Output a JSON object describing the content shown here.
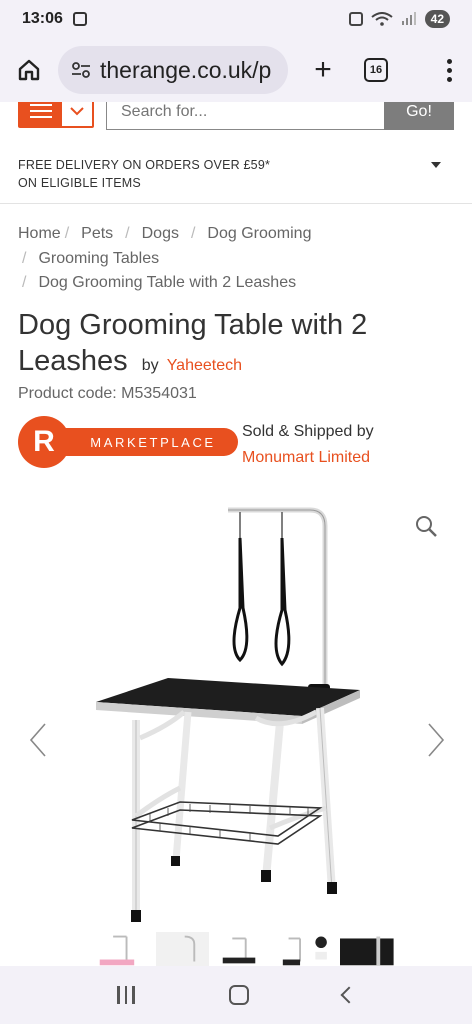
{
  "status": {
    "time": "13:06",
    "battery": "42"
  },
  "browser": {
    "url": "therange.co.uk/p",
    "tab_count": "16"
  },
  "header": {
    "search_placeholder": "Search for...",
    "go_label": "Go!"
  },
  "delivery": {
    "line1": "FREE DELIVERY ON ORDERS OVER £59*",
    "line2": "ON ELIGIBLE ITEMS"
  },
  "breadcrumb": [
    "Home",
    "Pets",
    "Dogs",
    "Dog Grooming",
    "Grooming Tables",
    "Dog Grooming Table with 2 Leashes"
  ],
  "product": {
    "title_line1": "Dog Grooming Table with 2",
    "title_line2": "Leashes",
    "by_label": "by",
    "brand": "Yaheetech",
    "code": "Product code: M5354031",
    "marketplace_letter": "R",
    "marketplace_label": "MARKETPLACE",
    "sold_by": "Sold & Shipped by",
    "seller": "Monumart Limited"
  },
  "icons": {
    "home": "home-icon",
    "tune": "tune-icon",
    "plus": "plus-icon",
    "tabs": "tabs-icon",
    "menu": "more-vert-icon",
    "zoom": "search-icon",
    "prev": "chevron-left-icon",
    "next": "chevron-right-icon"
  },
  "colors": {
    "accent": "#e8501f",
    "table_top": "#1e1e1e",
    "frame": "#f2f2f2"
  }
}
